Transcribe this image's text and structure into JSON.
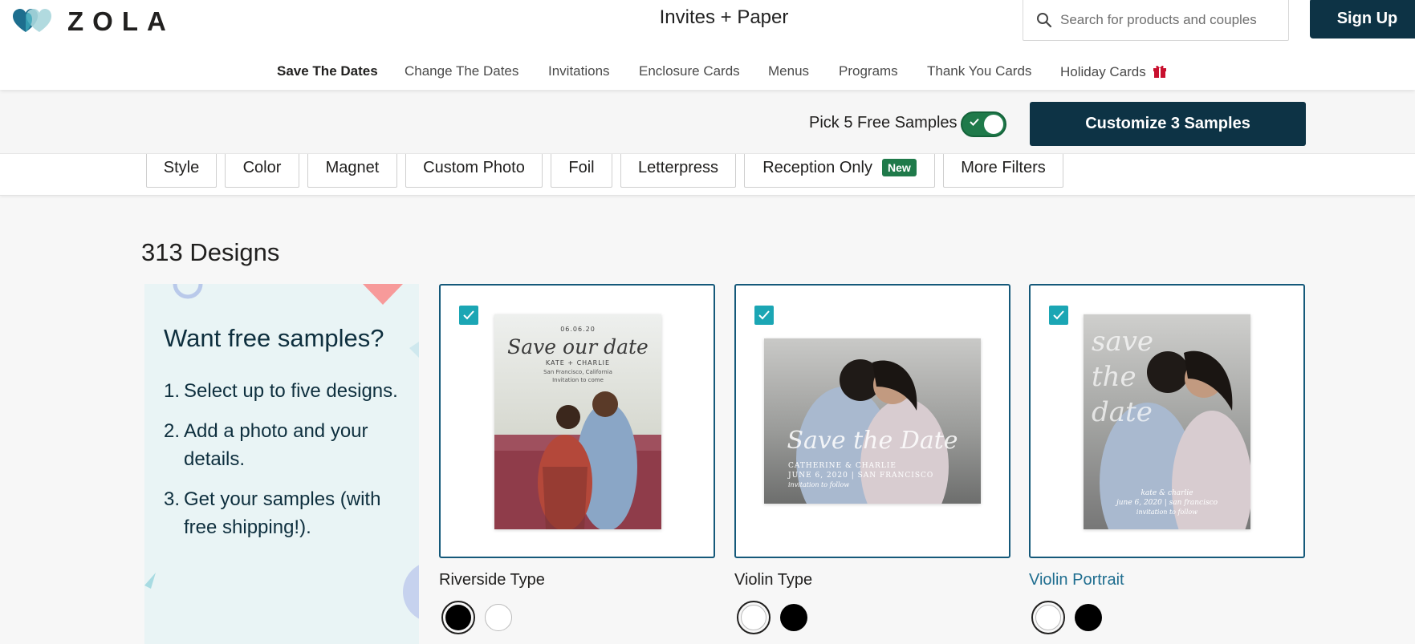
{
  "header": {
    "logo_text": "ZOLA",
    "site_title": "Invites + Paper",
    "search_placeholder": "Search for products and couples",
    "signup_label": "Sign Up"
  },
  "nav": {
    "items": [
      {
        "label": "Save The Dates"
      },
      {
        "label": "Change The Dates"
      },
      {
        "label": "Invitations"
      },
      {
        "label": "Enclosure Cards"
      },
      {
        "label": "Menus"
      },
      {
        "label": "Programs"
      },
      {
        "label": "Thank You Cards"
      },
      {
        "label": "Holiday Cards"
      }
    ]
  },
  "samples_bar": {
    "pick_label": "Pick 5 Free Samples",
    "toggle_on": true,
    "customize_label": "Customize 3 Samples"
  },
  "filters": {
    "items": [
      {
        "label": "Style"
      },
      {
        "label": "Color"
      },
      {
        "label": "Magnet"
      },
      {
        "label": "Custom Photo"
      },
      {
        "label": "Foil"
      },
      {
        "label": "Letterpress"
      },
      {
        "label": "Reception Only",
        "badge": "New"
      },
      {
        "label": "More Filters"
      }
    ]
  },
  "results": {
    "count_label": "313 Designs"
  },
  "promo": {
    "heading": "Want free samples?",
    "steps": [
      {
        "num": "1.",
        "text": "Select up to five designs."
      },
      {
        "num": "2.",
        "text": "Add a photo and your details."
      },
      {
        "num": "3.",
        "text": "Get your samples (with free shipping!)."
      }
    ]
  },
  "cards": [
    {
      "title": "Riverside Type",
      "checked": true,
      "preview": {
        "date": "06.06.20",
        "script": "Save our date",
        "names": "KATE + CHARLIE",
        "location": "San Francisco, California",
        "note": "Invitation to come"
      },
      "swatches": [
        "black",
        "white"
      ]
    },
    {
      "title": "Violin Type",
      "checked": true,
      "preview": {
        "script": "Save the Date",
        "names": "CATHERINE & CHARLIE",
        "details": "JUNE 6, 2020 | SAN FRANCISCO",
        "note": "invitation to follow"
      },
      "swatches": [
        "white",
        "black"
      ]
    },
    {
      "title": "Violin Portrait",
      "checked": true,
      "preview": {
        "script": "save the date",
        "names": "kate & charlie",
        "details": "june 6, 2020 | san francisco",
        "note": "invitation to follow"
      },
      "swatches": [
        "white",
        "black"
      ]
    }
  ],
  "colors": {
    "navy": "#0d3345",
    "teal_check": "#1ba6b4",
    "toggle_green": "#1f7a4a",
    "promo_bg": "#e9f4f5",
    "card_border": "#15597a"
  }
}
